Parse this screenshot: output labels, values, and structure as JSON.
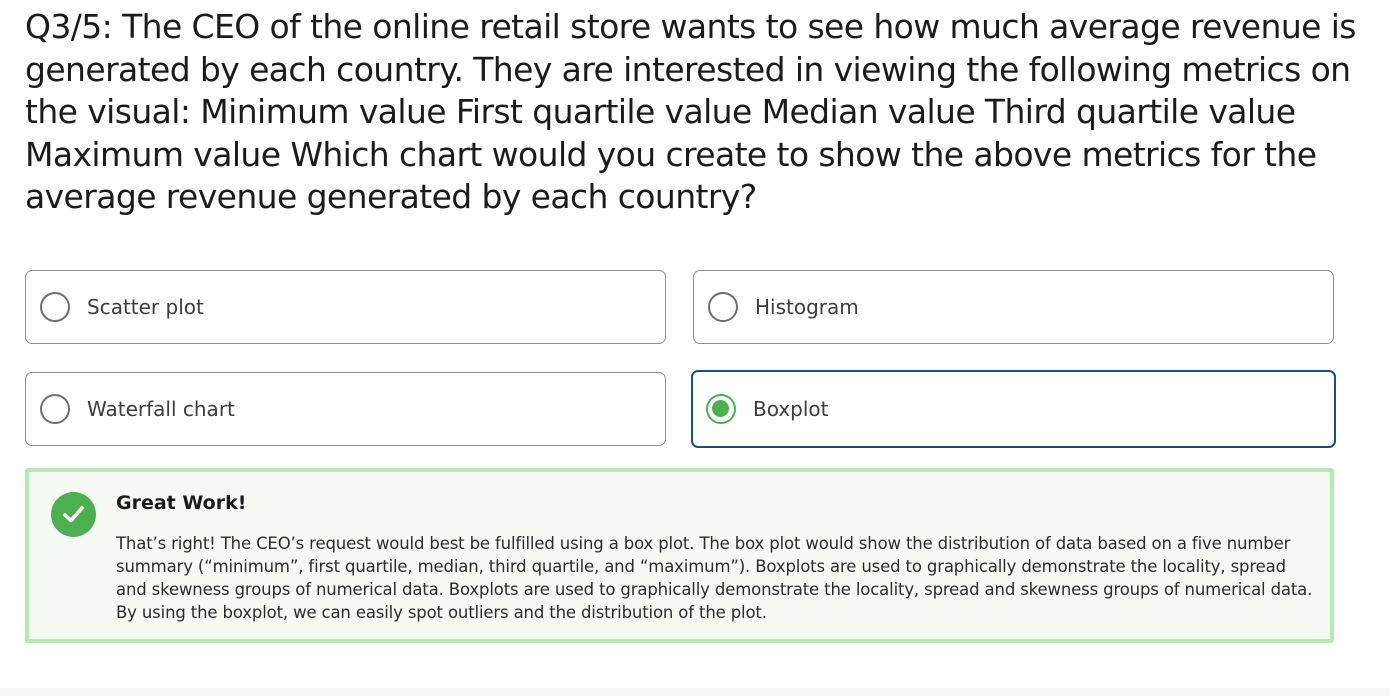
{
  "question": {
    "text": "Q3/5: The CEO of the online retail store wants to see how much average revenue is generated by each country. They are interested in viewing the following metrics on the visual: Minimum value First quartile value Median value Third quartile value Maximum value Which chart would you create to show the above metrics for the average revenue generated by each country?"
  },
  "options": [
    {
      "label": "Scatter plot",
      "selected": false
    },
    {
      "label": "Histogram",
      "selected": false
    },
    {
      "label": "Waterfall chart",
      "selected": false
    },
    {
      "label": "Boxplot",
      "selected": true
    }
  ],
  "feedback": {
    "title": "Great Work!",
    "body": "That’s right! The CEO’s request would best be fulfilled using a box plot. The box plot would show the distribution of data based on a five number summary (“minimum”, first quartile, median, third quartile, and “maximum”). Boxplots are used to graphically demonstrate the locality, spread and skewness groups of numerical data. Boxplots are used to graphically demonstrate the locality, spread and skewness groups of numerical data. By using the boxplot, we can easily spot outliers and the distribution of the plot.",
    "icon": "check-circle-icon",
    "accent_color": "#4caf50",
    "border_color": "#b5e8b3"
  },
  "colors": {
    "selected_border": "#1f4e79",
    "radio_selected": "#4caf50"
  }
}
